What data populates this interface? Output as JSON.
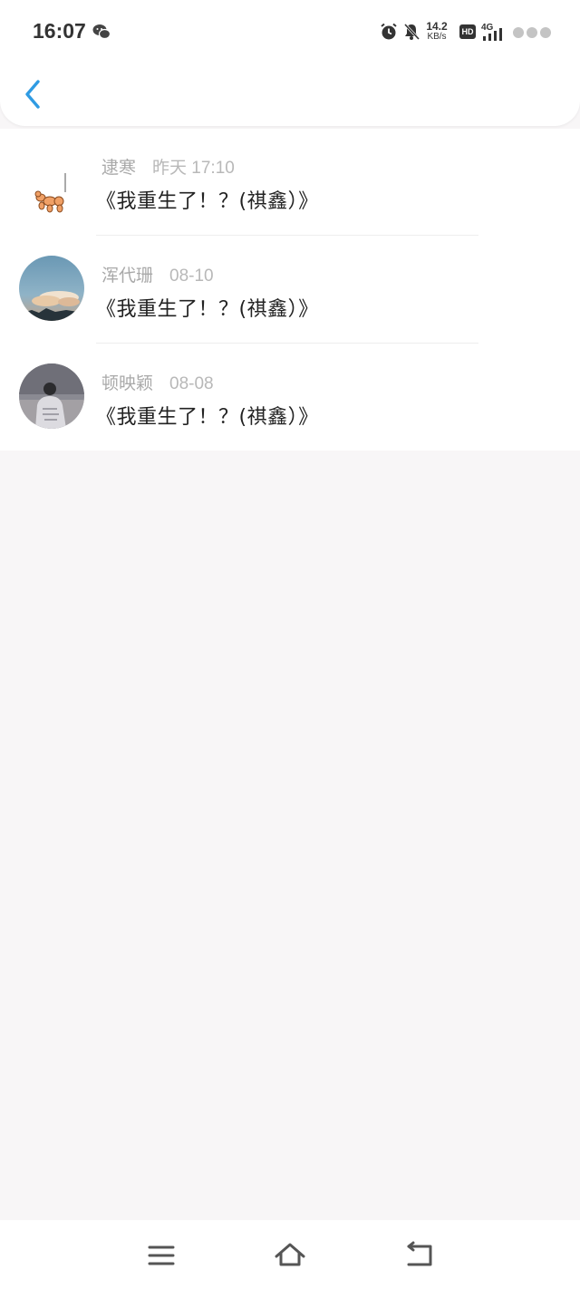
{
  "status_bar": {
    "time": "16:07",
    "net_speed_value": "14.2",
    "net_speed_unit": "KB/s",
    "hd_label": "HD",
    "network_label": "4G"
  },
  "header": {
    "back_icon": "chevron-left-icon",
    "accent_color": "#2f9be3"
  },
  "items": [
    {
      "author": "逮寒",
      "date": "昨天 17:10",
      "title": "《我重生了！？(祺鑫）》",
      "avatar": "balloon-dog"
    },
    {
      "author": "浑代珊",
      "date": "08-10",
      "title": "《我重生了！？(祺鑫）》",
      "avatar": "sky-clouds"
    },
    {
      "author": "顿映颖",
      "date": "08-08",
      "title": "《我重生了！？(祺鑫）》",
      "avatar": "person-back"
    }
  ],
  "nav": {
    "menu_icon": "menu-icon",
    "home_icon": "home-icon",
    "back_icon": "back-icon"
  }
}
